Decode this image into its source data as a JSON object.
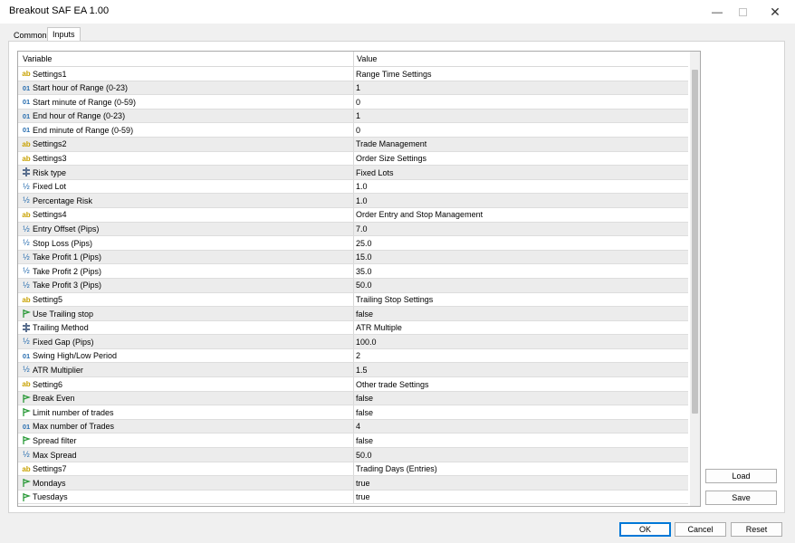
{
  "window": {
    "title": "Breakout SAF EA 1.00",
    "close_glyph": "✕",
    "minimize_glyph": "—"
  },
  "tabs": [
    {
      "label": "Common"
    },
    {
      "label": "Inputs",
      "active": true
    }
  ],
  "grid": {
    "headers": {
      "variable": "Variable",
      "value": "Value"
    },
    "rows": [
      {
        "icon": "ab",
        "variable": "Settings1",
        "value": "Range Time Settings"
      },
      {
        "icon": "01",
        "variable": "Start hour of Range (0-23)",
        "value": "1"
      },
      {
        "icon": "01",
        "variable": "Start minute of Range (0-59)",
        "value": "0"
      },
      {
        "icon": "01",
        "variable": "End hour of Range (0-23)",
        "value": "1"
      },
      {
        "icon": "01",
        "variable": "End minute of Range (0-59)",
        "value": "0"
      },
      {
        "icon": "ab",
        "variable": "Settings2",
        "value": "Trade Management"
      },
      {
        "icon": "ab",
        "variable": "Settings3",
        "value": "Order Size Settings"
      },
      {
        "icon": "enum",
        "variable": "Risk type",
        "value": "Fixed Lots"
      },
      {
        "icon": "half",
        "variable": "Fixed Lot",
        "value": "1.0"
      },
      {
        "icon": "half",
        "variable": "Percentage Risk",
        "value": "1.0"
      },
      {
        "icon": "ab",
        "variable": "Settings4",
        "value": "Order Entry and Stop Management"
      },
      {
        "icon": "half",
        "variable": "Entry Offset (Pips)",
        "value": "7.0"
      },
      {
        "icon": "half",
        "variable": "Stop Loss (Pips)",
        "value": "25.0"
      },
      {
        "icon": "half",
        "variable": "Take Profit 1 (Pips)",
        "value": "15.0"
      },
      {
        "icon": "half",
        "variable": "Take Profit 2 (Pips)",
        "value": "35.0"
      },
      {
        "icon": "half",
        "variable": "Take Profit 3 (Pips)",
        "value": "50.0"
      },
      {
        "icon": "ab",
        "variable": "Setting5",
        "value": "Trailing Stop Settings"
      },
      {
        "icon": "bool",
        "variable": "Use Trailing stop",
        "value": "false"
      },
      {
        "icon": "enum",
        "variable": "Trailing Method",
        "value": "ATR Multiple"
      },
      {
        "icon": "half",
        "variable": "Fixed Gap (Pips)",
        "value": "100.0"
      },
      {
        "icon": "01",
        "variable": "Swing High/Low Period",
        "value": "2"
      },
      {
        "icon": "half",
        "variable": "ATR Multiplier",
        "value": "1.5"
      },
      {
        "icon": "ab",
        "variable": "Setting6",
        "value": "Other trade Settings"
      },
      {
        "icon": "bool",
        "variable": "Break Even",
        "value": "false"
      },
      {
        "icon": "bool",
        "variable": "Limit number of trades",
        "value": "false"
      },
      {
        "icon": "01",
        "variable": "Max number of Trades",
        "value": "4"
      },
      {
        "icon": "bool",
        "variable": "Spread filter",
        "value": "false"
      },
      {
        "icon": "half",
        "variable": "Max Spread",
        "value": "50.0"
      },
      {
        "icon": "ab",
        "variable": "Settings7",
        "value": "Trading Days (Entries)"
      },
      {
        "icon": "bool",
        "variable": "Mondays",
        "value": "true"
      },
      {
        "icon": "bool",
        "variable": "Tuesdays",
        "value": "true"
      }
    ]
  },
  "side_buttons": {
    "load": "Load",
    "save": "Save"
  },
  "bottom_buttons": {
    "ok": "OK",
    "cancel": "Cancel",
    "reset": "Reset"
  }
}
